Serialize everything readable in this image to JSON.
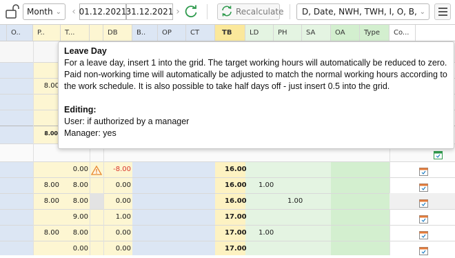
{
  "toolbar": {
    "period_select": "Month",
    "date_from": "01.12.2021",
    "date_to": "31.12.2021",
    "recalculate_label": "Recalculate",
    "columns_select": "D, Date, NWH, TWH, I, O, B,"
  },
  "columns": [
    "O..",
    "P..",
    "T...",
    "",
    "DB",
    "B..",
    "OP",
    "CT",
    "TB",
    "LD",
    "PH",
    "SA",
    "OA",
    "Type",
    "Co..."
  ],
  "partial_cells": {
    "p_row3": "8.00",
    "p_row5": "8.00"
  },
  "rows": [
    {
      "p": "",
      "t": "0.00",
      "db": "-8.00",
      "tb": "16.00",
      "ld": "",
      "ph": "",
      "warn": true
    },
    {
      "p": "8.00",
      "t": "8.00",
      "db": "0.00",
      "tb": "16.00",
      "ld": "1.00",
      "ph": "",
      "warn": false
    },
    {
      "p": "8.00",
      "t": "8.00",
      "db": "0.00",
      "tb": "16.00",
      "ld": "",
      "ph": "1.00",
      "warn": false
    },
    {
      "p": "",
      "t": "9.00",
      "db": "1.00",
      "tb": "17.00",
      "ld": "",
      "ph": "",
      "warn": false
    },
    {
      "p": "8.00",
      "t": "8.00",
      "db": "0.00",
      "tb": "17.00",
      "ld": "1.00",
      "ph": "",
      "warn": false
    },
    {
      "p": "",
      "t": "0.00",
      "db": "0.00",
      "tb": "17.00",
      "ld": "",
      "ph": "",
      "warn": false
    }
  ],
  "tooltip": {
    "title": "Leave Day",
    "body": "For a leave day, insert 1 into the grid. The target working hours will automatically be reduced to zero. Paid non-working time will automatically be adjusted to match the normal working hours according to the work schedule. It is also possible to take half days off - just insert 0.5 into the grid.",
    "editing_heading": "Editing:",
    "editing_user": "User: if authorized by a manager",
    "editing_manager": "Manager: yes"
  },
  "colors": {
    "blue_band": "#dce6f4",
    "yellow_band": "#fdf6d2",
    "green_band": "#e4f4e2",
    "green_band_dark": "#d3efcf",
    "tb_header": "#fbe89b",
    "negative": "#d9352b",
    "accent": "#1e7dc2"
  }
}
